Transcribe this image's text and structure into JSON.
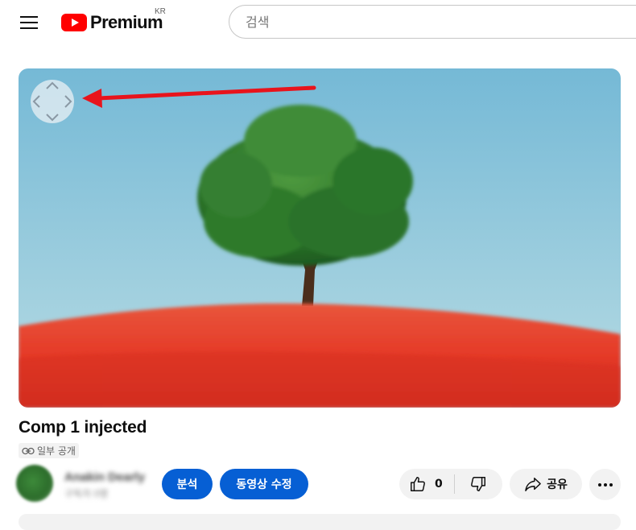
{
  "header": {
    "logo_text": "Premium",
    "logo_country": "KR",
    "search_placeholder": "검색"
  },
  "video": {
    "title": "Comp 1 injected",
    "visibility": "일부 공개"
  },
  "channel": {
    "name": "Anakin Dearly",
    "subscribers": "구독자 0명"
  },
  "actions": {
    "analytics_label": "분석",
    "edit_label": "동영상 수정",
    "like_count": "0",
    "share_label": "공유"
  },
  "colors": {
    "brand_red": "#ff0000",
    "action_blue": "#065fd4",
    "pill_bg": "#f2f2f2"
  },
  "icons": [
    "menu-icon",
    "youtube-logo-icon",
    "pan-control-icon",
    "link-icon",
    "thumbs-up-icon",
    "thumbs-down-icon",
    "share-icon",
    "more-icon"
  ]
}
